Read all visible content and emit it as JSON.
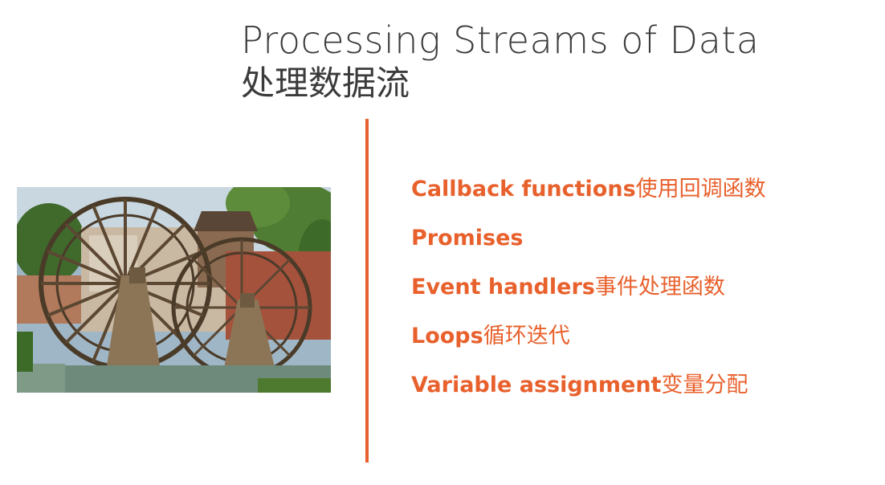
{
  "title": {
    "english": "Processing Streams of Data",
    "chinese": "处理数据流"
  },
  "image": {
    "subject": "wooden water wheels"
  },
  "bullets": [
    {
      "en": "Callback functions",
      "cn": "使用回调函数"
    },
    {
      "en": "Promises",
      "cn": ""
    },
    {
      "en": "Event handlers",
      "cn": "事件处理函数"
    },
    {
      "en": "Loops",
      "cn": "循环迭代"
    },
    {
      "en": "Variable assignment",
      "cn": "变量分配"
    }
  ],
  "colors": {
    "accent": "#e8612d",
    "title": "#3b3b3b",
    "background": "#ffffff"
  }
}
